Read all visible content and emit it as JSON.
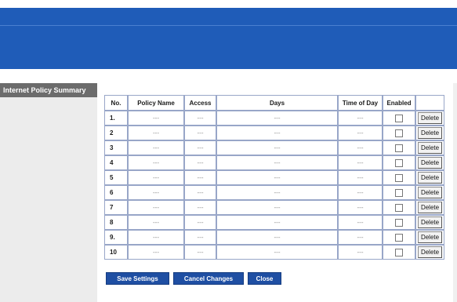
{
  "sidebar": {
    "heading": "Internet Policy Summary"
  },
  "table": {
    "headers": {
      "no": "No.",
      "policy_name": "Policy Name",
      "access": "Access",
      "days": "Days",
      "time_of_day": "Time of Day",
      "enabled": "Enabled"
    },
    "rows": [
      {
        "no": "1.",
        "policy_name": "---",
        "access": "---",
        "days": "---",
        "time_of_day": "---",
        "enabled": false,
        "delete": "Delete"
      },
      {
        "no": "2",
        "policy_name": "---",
        "access": "---",
        "days": "---",
        "time_of_day": "---",
        "enabled": false,
        "delete": "Delete"
      },
      {
        "no": "3",
        "policy_name": "---",
        "access": "---",
        "days": "---",
        "time_of_day": "---",
        "enabled": false,
        "delete": "Delete"
      },
      {
        "no": "4",
        "policy_name": "---",
        "access": "---",
        "days": "---",
        "time_of_day": "---",
        "enabled": false,
        "delete": "Delete"
      },
      {
        "no": "5",
        "policy_name": "---",
        "access": "---",
        "days": "---",
        "time_of_day": "---",
        "enabled": false,
        "delete": "Delete"
      },
      {
        "no": "6",
        "policy_name": "---",
        "access": "---",
        "days": "---",
        "time_of_day": "---",
        "enabled": false,
        "delete": "Delete"
      },
      {
        "no": "7",
        "policy_name": "---",
        "access": "---",
        "days": "---",
        "time_of_day": "---",
        "enabled": false,
        "delete": "Delete"
      },
      {
        "no": "8",
        "policy_name": "---",
        "access": "---",
        "days": "---",
        "time_of_day": "---",
        "enabled": false,
        "delete": "Delete"
      },
      {
        "no": "9.",
        "policy_name": "---",
        "access": "---",
        "days": "---",
        "time_of_day": "---",
        "enabled": false,
        "delete": "Delete"
      },
      {
        "no": "10",
        "policy_name": "---",
        "access": "---",
        "days": "---",
        "time_of_day": "---",
        "enabled": false,
        "delete": "Delete"
      }
    ]
  },
  "buttons": {
    "save": "Save Settings",
    "cancel": "Cancel Changes",
    "close": "Close"
  },
  "colors": {
    "banner": "#1f5cb8",
    "sidebar_heading": "#6c6c6c",
    "sidebar": "#ececec",
    "button": "#1f4fa3",
    "table_border": "#98a6c8"
  }
}
